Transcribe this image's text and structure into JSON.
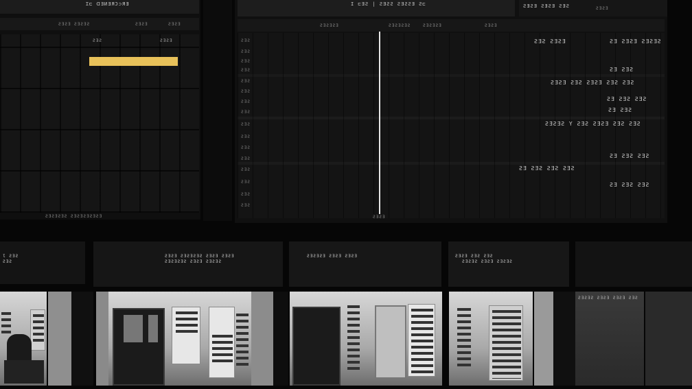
{
  "top_left_header": "Ɪ⊏ ᗡƎИƎЯƆ⊃ЯƎ",
  "top_center_header": "I ⊏ƎƧ | ƧƎƧƧ ƧƎƧƧƎ Ƨ⊏",
  "top_right_header": "ƧƎƧƎ ƧƎƧƎ ƧƎƧ",
  "top_right_subheader": "ƧƎƧƎ",
  "left_col_headers": [
    "ƧƎƧƎ ƧƎƧƎƧ",
    "ƧƎƧƎ",
    "ƧƎƧƎ"
  ],
  "left_cell_label": "ƧƎƧ",
  "left_cell_label_2": "ƧƎƧƎ",
  "left_footer": "ƧƎƧƎƧƎƧ ƧƎƧƎƧƎƧƎƧƎ",
  "right_col_headers": [
    "ƧƎƧƎƧƎ",
    "ƧƎƧƎƧƎƧ",
    "ƧƎƧƎƧƎ",
    "ƧƎƧƎ"
  ],
  "right_row_labels": [
    "ƧƎƧ",
    "ƧƎƧ",
    "ƧƎƧ",
    "ƧƎƧ",
    "ƧƎƧ",
    "ƧƎƧ",
    "ƧƎƧ",
    "ƧƎƧ",
    "ƧƎƧ",
    "ƧƎƧ",
    "ƧƎƧ",
    "ƧƎƧ",
    "ƧƎƧ",
    "ƧƎƧ",
    "ƧƎƧ",
    "ƧƎƧ"
  ],
  "right_values": [
    {
      "text": "ƧƎƧ ƧƎƧƎ"
    },
    {
      "text": "ƧƎ ƧƎƧƎ ƧƎƧƎƧ"
    },
    {
      "text": "ƧƎ ƧƎƧ"
    },
    {
      "text": "ƧƎƧƎ   ƧƎƧ ƧƎƧƎ   ƧƎƧ ƧƎƧ"
    },
    {
      "text": "ƧƎ ƧƎƧ ƧƎƧ"
    },
    {
      "text": "ƧƎ ƧƎƧ"
    },
    {
      "text": "ƧƎƧƎƧ Y ƧƎƧ ƧƎƧƎ ƧƎƧ ƧƎƧ"
    },
    {
      "text": "ƧƎ ƧƎƧ ƧƎƧ"
    },
    {
      "text": "ƧƎ ƧƎƧ     ƧƎƧ       ƧƎƧ"
    },
    {
      "text": "ƧƎ ƧƎƧ ƧƎƧ"
    }
  ],
  "right_footer": "ƧƎƧƎ",
  "bottom_panels": [
    {
      "title": "Ɩ ƧƎƧ",
      "sub": "ƧƎƧ"
    },
    {
      "title": "ƧƎƧƎ ƧƎƧƎƧƎƧ ƧƎƧƎ ƧƎƧƎ",
      "sub": "ƧƎƧƎƧƎƧ ƧƎƧƎ ƧƎƧƎƧ"
    },
    {
      "title": "ƧƎƧƎƧƎ ƧƎƧƎ ƧƎƧƎ",
      "sub": ""
    },
    {
      "title": "ƧƎƧƎ ƧƎƧ ƧƎƧ",
      "sub": "ƧƎƧƎƧ ƧƎƧƎ ƧƎƧƎƧ"
    },
    {
      "title": "",
      "sub": ""
    }
  ],
  "room_board_text": "ƧƎƧƎƧ ƧƎƧƎ ƧƎƧƎ ƧƎƧ",
  "accent_color": "#e8c15a"
}
